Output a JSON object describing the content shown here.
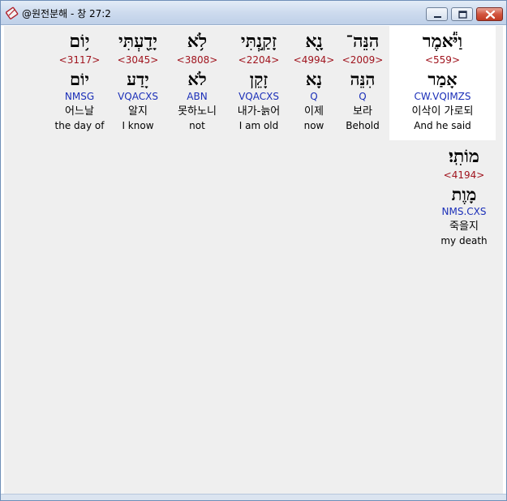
{
  "window": {
    "title": "@원전분해 - 창 27:2"
  },
  "words": [
    {
      "hebrew": "וַיֹּ֕אמֶר",
      "strong": "<559>",
      "lemma": "אָמַר",
      "morph": "CW.VQIMZS",
      "korean": "이삭이 가로되",
      "english": "And he said"
    },
    {
      "hebrew": "הִנֵּה־",
      "strong": "<2009>",
      "lemma": "הִנֵּה",
      "morph": "Q",
      "korean": "보라",
      "english": "Behold"
    },
    {
      "hebrew": "נָ֖א",
      "strong": "<4994>",
      "lemma": "נָא",
      "morph": "Q",
      "korean": "이제",
      "english": "now"
    },
    {
      "hebrew": "זָקַ֣נְתִּי",
      "strong": "<2204>",
      "lemma": "זָקֵן",
      "morph": "VQACXS",
      "korean": "내가-늙어",
      "english": "I am old"
    },
    {
      "hebrew": "לֹ֥א",
      "strong": "<3808>",
      "lemma": "לֹא",
      "morph": "ABN",
      "korean": "못하노니",
      "english": "not"
    },
    {
      "hebrew": "יָדַ֖עְתִּי",
      "strong": "<3045>",
      "lemma": "יָדַע",
      "morph": "VQACXS",
      "korean": "알지",
      "english": "I know"
    },
    {
      "hebrew": "י֥וֹם",
      "strong": "<3117>",
      "lemma": "יוֹם",
      "morph": "NMSG",
      "korean": "어느날",
      "english": "the day of"
    },
    {
      "hebrew": "מוֹתִֽי׃",
      "strong": "<4194>",
      "lemma": "מָוֶת",
      "morph": "NMS.CXS",
      "korean": "죽을지",
      "english": "my death"
    }
  ]
}
